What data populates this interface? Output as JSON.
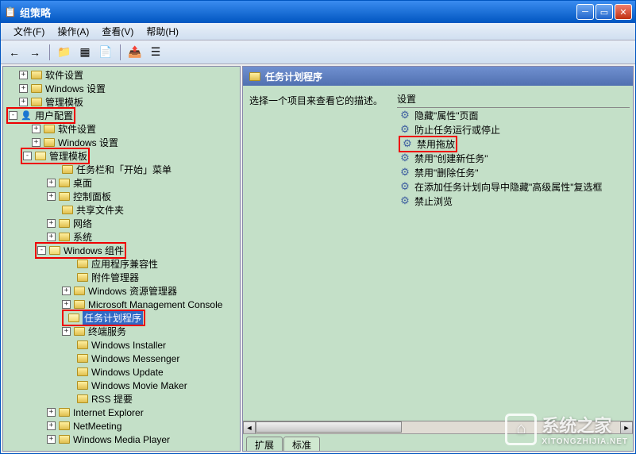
{
  "window": {
    "title": "组策略"
  },
  "menu": {
    "file": "文件(F)",
    "action": "操作(A)",
    "view": "查看(V)",
    "help": "帮助(H)"
  },
  "tree": {
    "i0": "软件设置",
    "i1": "Windows 设置",
    "i2": "管理模板",
    "i3": "用户配置",
    "i4": "软件设置",
    "i5": "Windows 设置",
    "i6": "管理模板",
    "i7": "任务栏和「开始」菜单",
    "i8": "桌面",
    "i9": "控制面板",
    "i10": "共享文件夹",
    "i11": "网络",
    "i12": "系统",
    "i13": "Windows 组件",
    "i14": "应用程序兼容性",
    "i15": "附件管理器",
    "i16": "Windows 资源管理器",
    "i17": "Microsoft Management Console",
    "i18": "任务计划程序",
    "i19": "终端服务",
    "i20": "Windows Installer",
    "i21": "Windows Messenger",
    "i22": "Windows Update",
    "i23": "Windows Movie Maker",
    "i24": "RSS 提要",
    "i25": "Internet Explorer",
    "i26": "NetMeeting",
    "i27": "Windows Media Player"
  },
  "right": {
    "header": "任务计划程序",
    "instruction": "选择一个项目来查看它的描述。",
    "settings_header": "设置",
    "items": {
      "s0": "隐藏\"属性\"页面",
      "s1": "防止任务运行或停止",
      "s2": "禁用拖放",
      "s3": "禁用\"创建新任务\"",
      "s4": "禁用\"删除任务\"",
      "s5": "在添加任务计划向导中隐藏\"高级属性\"复选框",
      "s6": "禁止浏览"
    }
  },
  "tabs": {
    "ext": "扩展",
    "std": "标准"
  },
  "watermark": {
    "main": "系统之家",
    "sub": "XITONGZHIJIA.NET"
  }
}
